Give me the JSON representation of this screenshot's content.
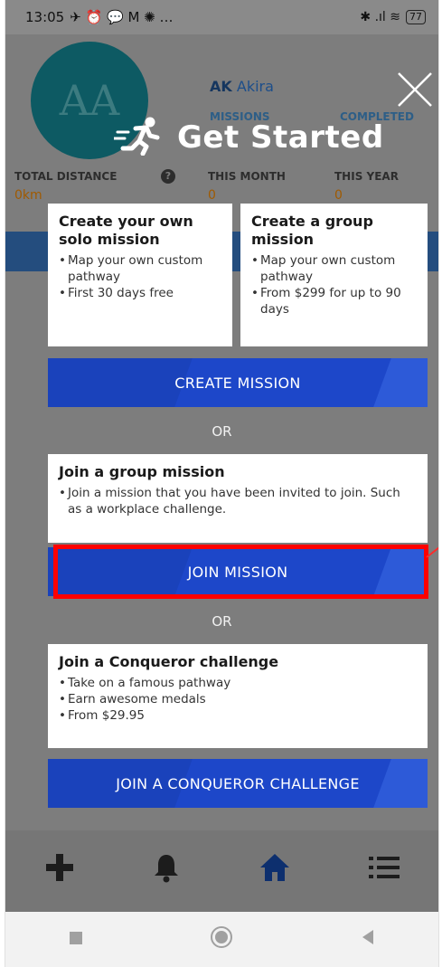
{
  "status_bar": {
    "time": "13:05",
    "left_icons": "✈ ⏰ 💬 M ✺ …",
    "right_icons": "✱ .ıl ≋",
    "battery": "77"
  },
  "background": {
    "avatar_initials": "AA",
    "user_initials": "AK",
    "user_name": "Akira",
    "missions_label": "MISSIONS",
    "completed_label": "COMPLETED",
    "total_distance_label": "TOTAL DISTANCE",
    "total_distance_value": "0km",
    "this_month_label": "THIS MONTH",
    "this_month_value": "0",
    "this_year_label": "THIS YEAR",
    "this_year_value": "0"
  },
  "overlay": {
    "title": "Get Started",
    "cards": {
      "solo": {
        "title": "Create your own solo mission",
        "items": [
          "Map your own custom pathway",
          "First 30 days free"
        ]
      },
      "group": {
        "title": "Create a group mission",
        "items": [
          "Map your own custom pathway",
          "From $299 for up to 90 days"
        ]
      },
      "join_group": {
        "title": "Join a group mission",
        "items": [
          "Join a mission that you have been invited to join. Such as a workplace challenge."
        ]
      },
      "conqueror": {
        "title": "Join a Conqueror challenge",
        "items": [
          "Take on a famous pathway",
          "Earn awesome medals",
          "From $29.95"
        ]
      }
    },
    "create_mission_label": "CREATE MISSION",
    "or_label_1": "OR",
    "join_mission_label": "JOIN MISSION",
    "or_label_2": "OR",
    "join_conqueror_label": "JOIN A CONQUEROR CHALLENGE"
  },
  "bottom_nav": {
    "icons": [
      "plus-icon",
      "bell-icon",
      "home-icon",
      "list-icon"
    ]
  },
  "system_nav": {
    "icons": [
      "recents-icon",
      "home-circle-icon",
      "back-icon"
    ]
  },
  "colors": {
    "button_blue": "#1d47c9",
    "highlight_red": "#ff0000",
    "overlay_gray": "#7d7d7d"
  }
}
